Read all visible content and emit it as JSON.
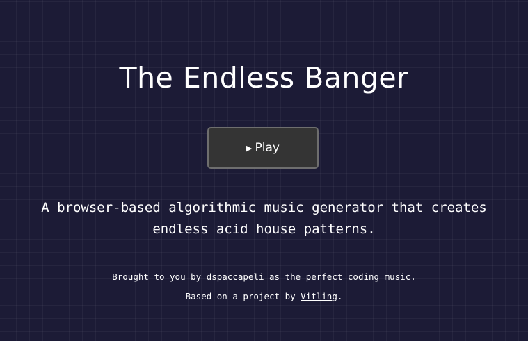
{
  "header": {
    "title": "The Endless Banger"
  },
  "controls": {
    "play_icon": "▶",
    "play_label": "Play"
  },
  "description": {
    "line1": "A browser-based algorithmic music generator that creates",
    "line2": "endless acid house patterns."
  },
  "credits": {
    "line1_prefix": "Brought to you by ",
    "line1_link": "dspaccapeli",
    "line1_suffix": " as the perfect coding music.",
    "line2_prefix": "Based on a project by ",
    "line2_link": "Vitling",
    "line2_suffix": "."
  },
  "colors": {
    "background": "#1c1b36",
    "button_bg": "#343434",
    "button_border": "#6e6e6e",
    "text": "#ffffff"
  },
  "icons": {
    "play": "play-icon"
  }
}
